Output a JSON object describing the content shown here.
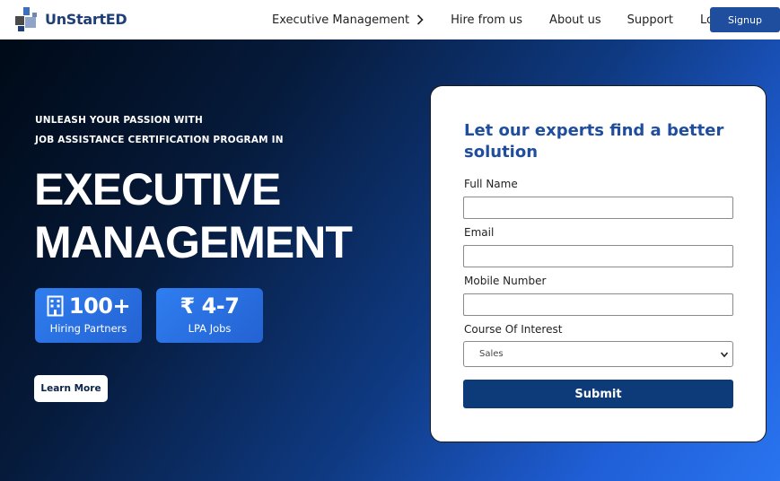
{
  "brand": {
    "name": "UnStartED"
  },
  "nav": {
    "items": [
      {
        "label": "Executive Management",
        "icon": "chevron-right-icon"
      },
      {
        "label": "Hire from us"
      },
      {
        "label": "About us"
      },
      {
        "label": "Support"
      },
      {
        "label": "Login"
      }
    ],
    "signup_label": "Signup"
  },
  "hero": {
    "tagline_line1": "UNLEASH YOUR PASSION WITH",
    "tagline_line2": "JOB ASSISTANCE CERTIFICATION PROGRAM IN",
    "headline_line1": "EXECUTIVE",
    "headline_line2": "MANAGEMENT",
    "stats": [
      {
        "icon": "building-icon",
        "value": "100+",
        "label": "Hiring Partners"
      },
      {
        "icon": "rupee-icon",
        "value": "₹ 4-7",
        "label": "LPA Jobs"
      }
    ],
    "learn_more_label": "Learn More"
  },
  "form": {
    "title": "Let our experts find a better solution",
    "fields": [
      {
        "label": "Full Name",
        "value": ""
      },
      {
        "label": "Email",
        "value": ""
      },
      {
        "label": "Mobile Number",
        "value": ""
      }
    ],
    "course": {
      "label": "Course Of Interest",
      "selected": "Sales"
    },
    "submit_label": "Submit"
  },
  "colors": {
    "brand_blue": "#1f4e9e",
    "submit_blue": "#0d3a78",
    "hero_dark": "#000a17",
    "hero_bright": "#2a74f0"
  }
}
